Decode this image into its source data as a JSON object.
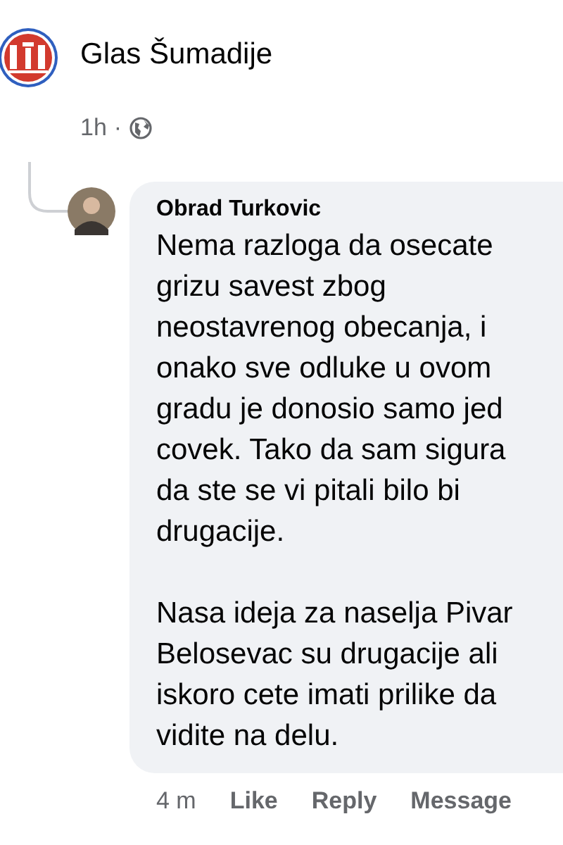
{
  "post": {
    "author": "Glas Šumadije",
    "time": "1h",
    "separator": "·"
  },
  "comment": {
    "author": "Obrad Turkovic",
    "paragraphs": [
      [
        "Nema razloga da osecate",
        "grizu savest zbog",
        "neostavrenog obecanja, i",
        "onako sve odluke u ovom",
        "gradu je donosio samo jed",
        "covek. Tako da sam sigura",
        "da ste se vi pitali bilo bi",
        "drugacije."
      ],
      [
        "Nasa ideja za naselja Pivar",
        "Belosevac su drugacije ali",
        "iskoro cete imati prilike da",
        "vidite na delu."
      ]
    ],
    "time": "4 m",
    "actions": [
      "Like",
      "Reply",
      "Message"
    ]
  }
}
